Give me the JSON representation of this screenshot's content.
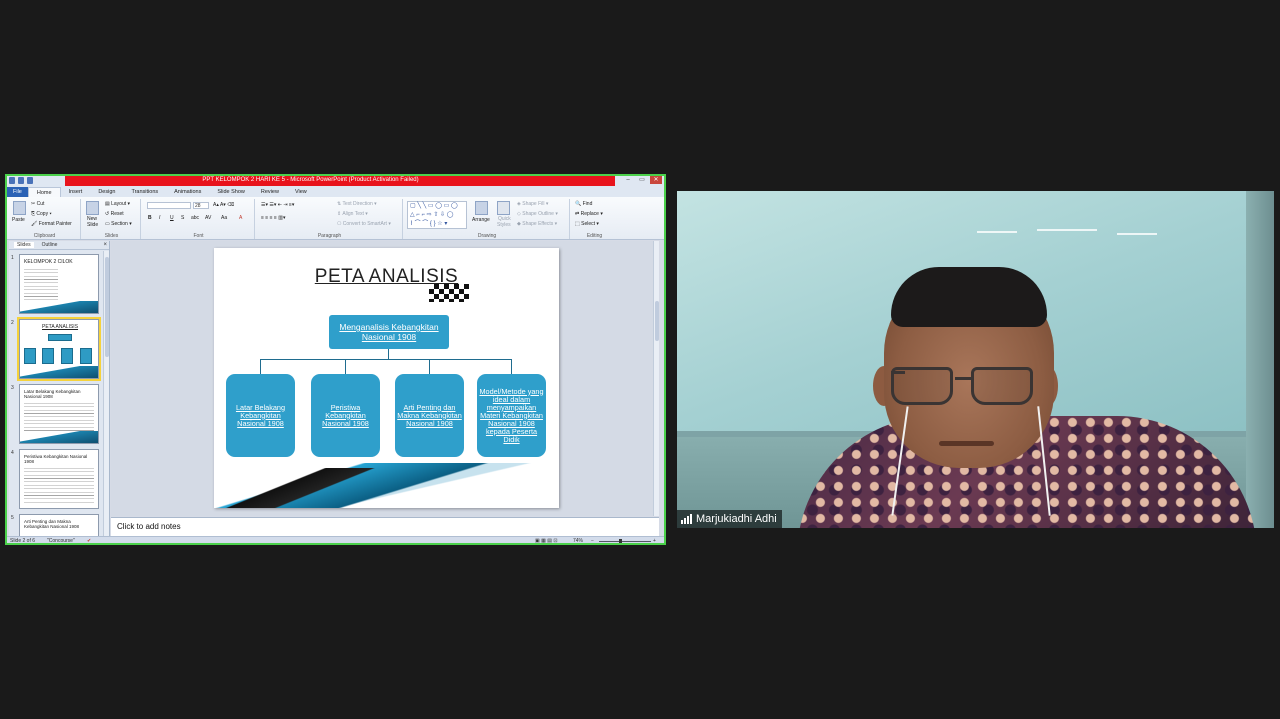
{
  "window": {
    "title": "PPT KELOMPOK 2 HARI KE 5  -  Microsoft PowerPoint (Product Activation Failed)"
  },
  "ribbon": {
    "tabs": [
      "File",
      "Home",
      "Insert",
      "Design",
      "Transitions",
      "Animations",
      "Slide Show",
      "Review",
      "View"
    ],
    "active_tab": "Home",
    "clipboard": {
      "paste": "Paste",
      "cut": "Cut",
      "copy": "Copy",
      "format_painter": "Format Painter",
      "label": "Clipboard"
    },
    "slides": {
      "new_slide": "New",
      "new_slide2": "Slide",
      "layout": "Layout",
      "reset": "Reset",
      "section": "Section",
      "label": "Slides"
    },
    "font": {
      "size": "28",
      "bold": "B",
      "italic": "I",
      "underline": "U",
      "strike": "S",
      "shadow": "abc",
      "spacing": "AV",
      "case": "Aa",
      "color": "A",
      "label": "Font"
    },
    "paragraph": {
      "text_direction": "Text Direction",
      "align_text": "Align Text",
      "smartart": "Convert to SmartArt",
      "label": "Paragraph"
    },
    "drawing": {
      "arrange": "Arrange",
      "quick_styles": "Quick",
      "quick_styles2": "Styles",
      "shape_fill": "Shape Fill",
      "shape_outline": "Shape Outline",
      "shape_effects": "Shape Effects",
      "label": "Drawing"
    },
    "editing": {
      "find": "Find",
      "replace": "Replace",
      "select": "Select",
      "label": "Editing"
    }
  },
  "left_pane": {
    "tabs": [
      "Slides",
      "Outline"
    ],
    "thumbnails": [
      {
        "num": "1",
        "title": "KELOMPOK 2   CILOK"
      },
      {
        "num": "2",
        "title": "PETA ANALISIS"
      },
      {
        "num": "3",
        "title": "Latar Belakang Kebangkitan Nasional 1908"
      },
      {
        "num": "4",
        "title": "Peristiwa Kebangkitan Nasional 1908"
      },
      {
        "num": "5",
        "title": "Arti Penting dan Makna Kebangkitan Nasional 1908"
      }
    ]
  },
  "slide": {
    "title": "PETA ANALISIS",
    "root": "Menganalisis Kebangkitan Nasional 1908",
    "children": [
      "Latar Belakang Kebangkitan Nasional 1908",
      "Peristiwa Kebangkitan Nasional 1908",
      "Arti Penting dan Makna Kebangkitan Nasional 1908",
      "Model/Metode yang ideal dalam menyampaikan Materi Kebangkitan Nasional 1908 kepada Peserta Didik"
    ]
  },
  "notes": {
    "placeholder": "Click to add notes"
  },
  "status": {
    "slide": "Slide 2 of 6",
    "theme": "\"Concourse\"",
    "zoom": "74%"
  },
  "participant": {
    "name": "Marjukiadhi Adhi"
  }
}
